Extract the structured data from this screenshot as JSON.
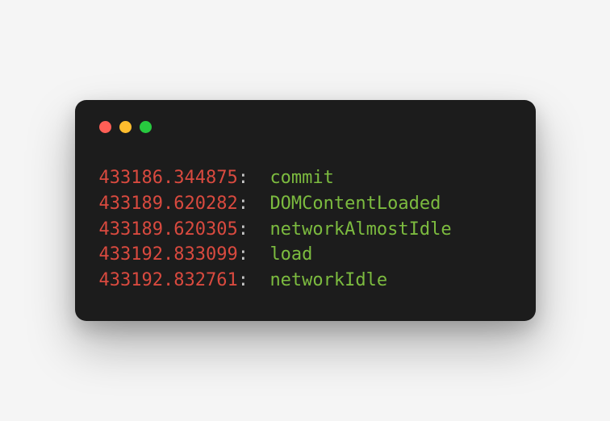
{
  "colors": {
    "timestamp": "#d94a3f",
    "event": "#7cbb3f",
    "background": "#1c1c1c"
  },
  "traffic_lights": {
    "red": "#ff5f56",
    "yellow": "#ffbd2e",
    "green": "#27c93f"
  },
  "logs": [
    {
      "timestamp": "433186.344875",
      "sep": ":  ",
      "event": "commit"
    },
    {
      "timestamp": "433189.620282",
      "sep": ":  ",
      "event": "DOMContentLoaded"
    },
    {
      "timestamp": "433189.620305",
      "sep": ":  ",
      "event": "networkAlmostIdle"
    },
    {
      "timestamp": "433192.833099",
      "sep": ":  ",
      "event": "load"
    },
    {
      "timestamp": "433192.832761",
      "sep": ":  ",
      "event": "networkIdle"
    }
  ]
}
